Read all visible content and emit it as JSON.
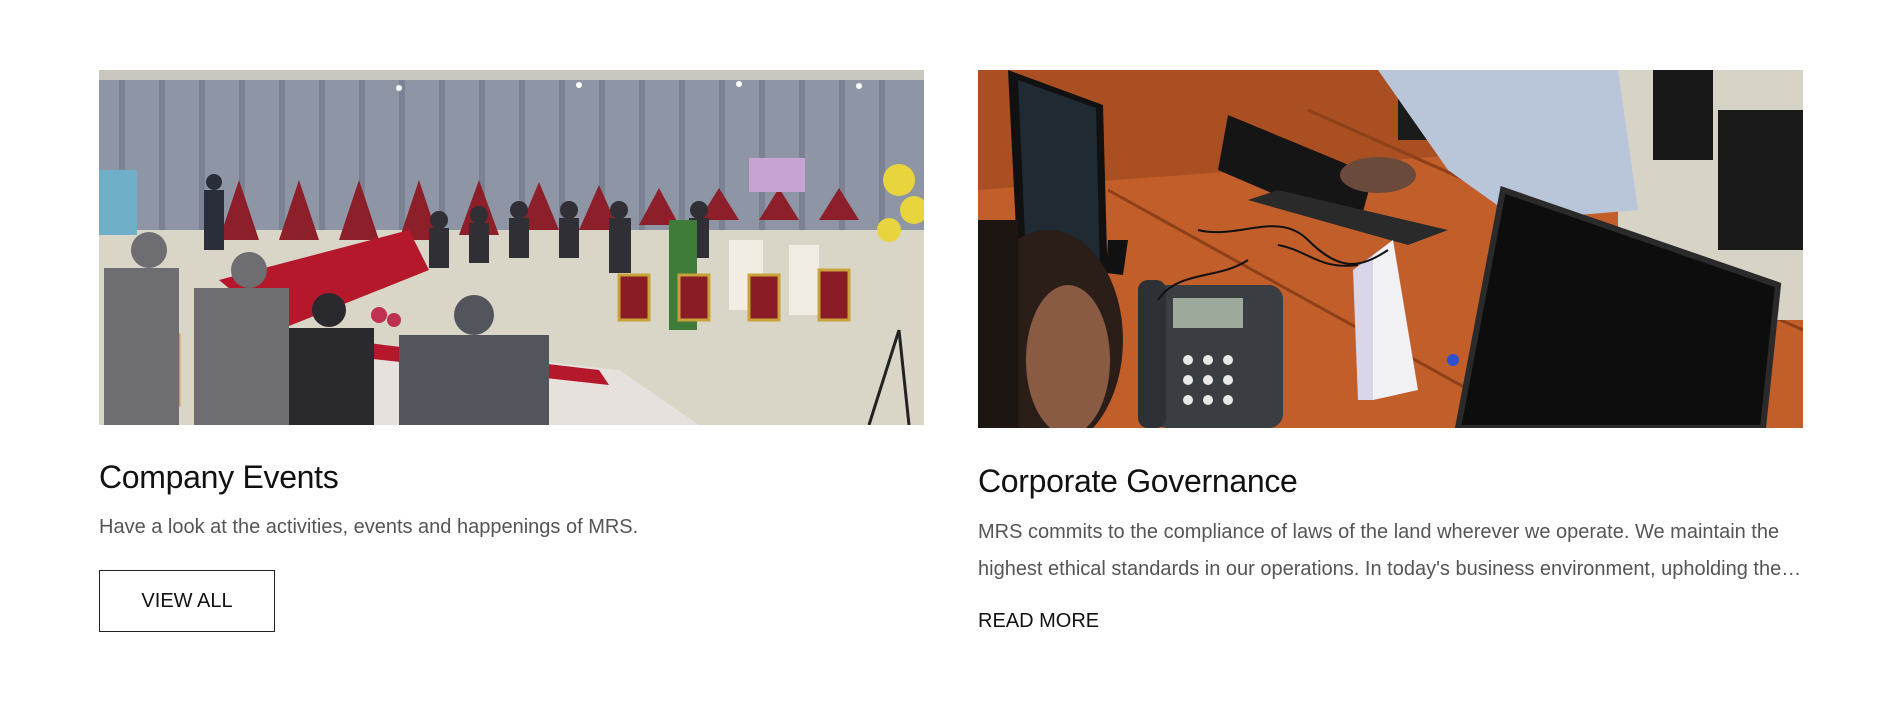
{
  "cards": [
    {
      "title": "Company Events",
      "description": "Have a look at the activities, events and happenings of MRS.",
      "action_label": "VIEW ALL",
      "image": "conference-hall-meeting-photo"
    },
    {
      "title": "Corporate Governance",
      "description": "MRS commits to the compliance of laws of the land wherever we operate. We maintain the highest ethical standards in our operations. In today's business environment, upholding the highest standards of corporate governance is essential.",
      "action_label": "READ MORE",
      "image": "office-workstation-photo"
    }
  ]
}
